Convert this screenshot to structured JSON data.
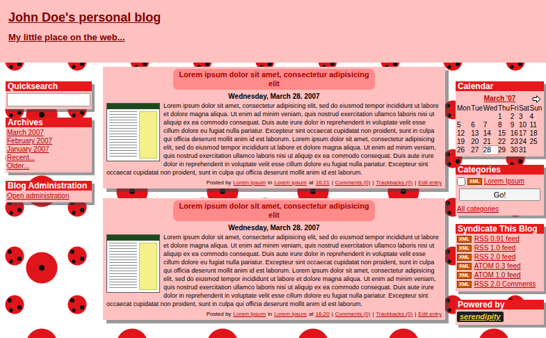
{
  "header": {
    "title": "John Doe's personal blog",
    "subtitle": "My little place on the web..."
  },
  "left_sidebar": {
    "quicksearch": {
      "title": "Quicksearch"
    },
    "archives": {
      "title": "Archives",
      "links": [
        "March 2007",
        "February 2007",
        "January 2007",
        "Recent...",
        "Older..."
      ]
    },
    "admin": {
      "title": "Blog Administration",
      "links": [
        "Open administration"
      ]
    }
  },
  "entries": [
    {
      "title": "Lorem ipsum dolor sit amet, consectetur adipisicing elit",
      "date": "Wednesday, March 28. 2007",
      "body": "Lorem ipsum dolor sit amet, consectetur adipisicing elit, sed do eiusmod tempor incididunt ut labore et dolore magna aliqua. Ut enim ad minim veniam, quis nostrud exercitation ullamco laboris nisi ut aliquip ex ea commodo consequat. Duis aute irure dolor in reprehenderit in voluptate velit esse cillum dolore eu fugiat nulla pariatur. Excepteur sint occaecat cupidatat non proident, sunt in culpa qui officia deserunt mollit anim id est laborum. Lorem ipsum dolor sit amet, consectetur adipisicing elit, sed do eiusmod tempor incididunt ut labore et dolore magna aliqua. Ut enim ad minim veniam, quis nostrud exercitation ullamco laboris nisi ut aliquip ex ea commodo consequat. Duis aute irure dolor in reprehenderit in voluptate velit esse cillum dolore eu fugiat nulla pariatur. Excepteur sint occaecat cupidatat non proident, sunt in culpa qui officia deserunt mollit anim id est laborum.",
      "footer": {
        "posted_label": "Posted by",
        "author": "Lorem Ipsum",
        "in_label": "in",
        "category": "Lorem Ipsum",
        "at_label": "at",
        "time": "16:21",
        "separator": "|",
        "comments": "Comments (0)",
        "trackbacks": "Trackbacks (0)",
        "edit": "Edit entry"
      }
    },
    {
      "title": "Lorem ipsum dolor sit amet, consectetur adipisicing elit",
      "date": "Wednesday, March 28. 2007",
      "body": "Lorem ipsum dolor sit amet, consectetur adipisicing elit, sed do eiusmod tempor incididunt ut labore et dolore magna aliqua. Ut enim ad minim veniam, quis nostrud exercitation ullamco laboris nisi ut aliquip ex ea commodo consequat. Duis aute irure dolor in reprehenderit in voluptate velit esse cillum dolore eu fugiat nulla pariatur. Excepteur sint occaecat cupidatat non proident, sunt in culpa qui officia deserunt mollit anim id est laborum. Lorem ipsum dolor sit amet, consectetur adipisicing elit, sed do eiusmod tempor incididunt ut labore et dolore magna aliqua. Ut enim ad minim veniam, quis nostrud exercitation ullamco laboris nisi ut aliquip ex ea commodo consequat. Duis aute irure dolor in reprehenderit in voluptate velit esse cillum dolore eu fugiat nulla pariatur. Excepteur sint occaecat cupidatat non proident, sunt in culpa qui officia deserunt mollit anim id est laborum.",
      "footer": {
        "posted_label": "Posted by",
        "author": "Lorem Ipsum",
        "in_label": "in",
        "category": "Lorem Ipsum",
        "at_label": "at",
        "time": "16:20",
        "separator": "|",
        "comments": "Comments (0)",
        "trackbacks": "Trackbacks (0)",
        "edit": "Edit entry"
      }
    }
  ],
  "right_sidebar": {
    "calendar": {
      "title": "Calendar",
      "month": "March '07",
      "weekdays": [
        "Mon",
        "Tue",
        "Wed",
        "Thu",
        "Fri",
        "Sat",
        "Sun"
      ],
      "weeks": [
        [
          {
            "day": "",
            "today": false
          },
          {
            "day": "",
            "today": false
          },
          {
            "day": "",
            "today": false
          },
          {
            "day": "1",
            "today": false
          },
          {
            "day": "2",
            "today": false
          },
          {
            "day": "3",
            "today": false
          },
          {
            "day": "4",
            "today": false
          }
        ],
        [
          {
            "day": "5",
            "today": false
          },
          {
            "day": "6",
            "today": false
          },
          {
            "day": "7",
            "today": false
          },
          {
            "day": "8",
            "today": false
          },
          {
            "day": "9",
            "today": false
          },
          {
            "day": "10",
            "today": false
          },
          {
            "day": "11",
            "today": false
          }
        ],
        [
          {
            "day": "12",
            "today": false
          },
          {
            "day": "13",
            "today": false
          },
          {
            "day": "14",
            "today": false
          },
          {
            "day": "15",
            "today": false
          },
          {
            "day": "16",
            "today": false
          },
          {
            "day": "17",
            "today": false
          },
          {
            "day": "18",
            "today": false
          }
        ],
        [
          {
            "day": "19",
            "today": false
          },
          {
            "day": "20",
            "today": false
          },
          {
            "day": "21",
            "today": false
          },
          {
            "day": "22",
            "today": false
          },
          {
            "day": "23",
            "today": false
          },
          {
            "day": "24",
            "today": false
          },
          {
            "day": "25",
            "today": false
          }
        ],
        [
          {
            "day": "26",
            "today": false
          },
          {
            "day": "27",
            "today": false
          },
          {
            "day": "28",
            "today": true
          },
          {
            "day": "29",
            "today": false
          },
          {
            "day": "30",
            "today": false
          },
          {
            "day": "31",
            "today": false
          },
          {
            "day": "",
            "today": false
          }
        ]
      ]
    },
    "categories": {
      "title": "Categories",
      "items": [
        {
          "label": "Lorem Ipsum",
          "badge": "XML",
          "checked": false
        }
      ],
      "button": "Go!",
      "all_link": "All categories"
    },
    "syndicate": {
      "title": "Syndicate This Blog",
      "feeds": [
        {
          "badge": "XML",
          "label": "RSS 0.91 feed"
        },
        {
          "badge": "XML",
          "label": "RSS 1.0 feed"
        },
        {
          "badge": "XML",
          "label": "RSS 2.0 feed"
        },
        {
          "badge": "XML",
          "label": "ATOM 0.3 feed"
        },
        {
          "badge": "XML",
          "label": "ATOM 1.0 feed"
        },
        {
          "badge": "XML",
          "label": "RSS 2.0 Comments"
        }
      ]
    },
    "powered": {
      "title": "Powered by",
      "logo": "serendipity"
    }
  }
}
